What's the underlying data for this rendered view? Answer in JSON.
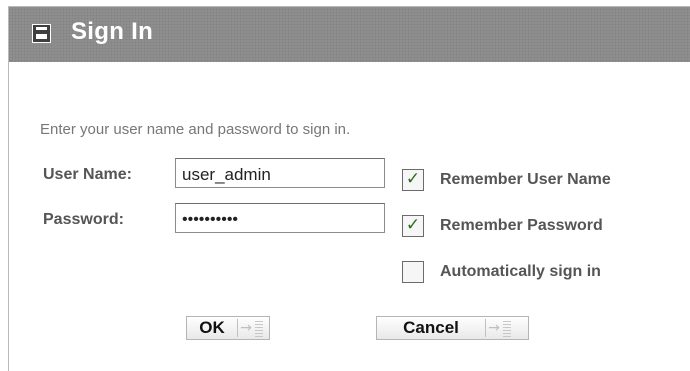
{
  "dialog": {
    "title": "Sign In",
    "title_icon": "window-minimize-icon",
    "instruction": "Enter your user name and password to sign in."
  },
  "form": {
    "username": {
      "label": "User Name:",
      "value": "user_admin"
    },
    "password": {
      "label": "Password:",
      "value": "••••••••••"
    },
    "options": [
      {
        "label": "Remember User Name",
        "checked": true
      },
      {
        "label": "Remember Password",
        "checked": true
      },
      {
        "label": "Automatically sign in",
        "checked": false
      }
    ]
  },
  "buttons": {
    "ok_label": "OK",
    "cancel_label": "Cancel",
    "arrow_icon": "→"
  },
  "colors": {
    "title_bar": "#8f8f8f",
    "checkmark": "#2d6b1e",
    "label_text": "#555555"
  }
}
